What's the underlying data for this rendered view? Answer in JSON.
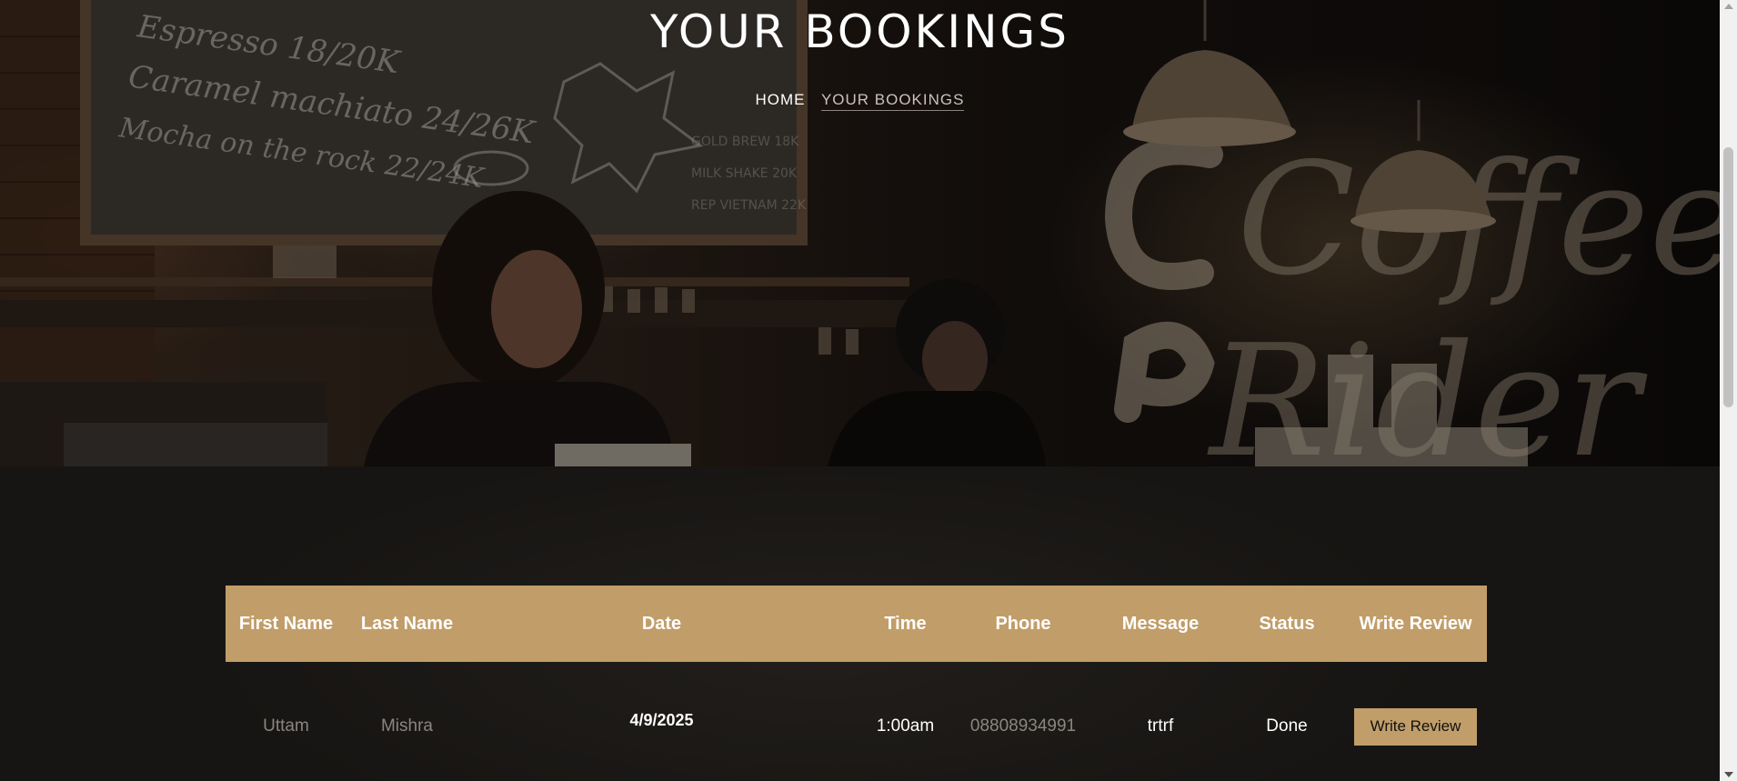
{
  "hero": {
    "title": "YOUR BOOKINGS",
    "breadcrumb": {
      "home": "HOME",
      "current": "YOUR BOOKINGS"
    },
    "photo_menu_lines": [
      "Espresso 18/20K",
      "Caramel machiato 24/26K",
      "Mocha on the rock 22/24K"
    ],
    "photo_signage": [
      "Coffee",
      "Rider"
    ]
  },
  "table": {
    "headers": {
      "first_name": "First Name",
      "last_name": "Last Name",
      "date": "Date",
      "time": "Time",
      "phone": "Phone",
      "message": "Message",
      "status": "Status",
      "review": "Write Review"
    },
    "rows": [
      {
        "first_name": "Uttam",
        "last_name": "Mishra",
        "date": "4/9/2025",
        "time": "1:00am",
        "phone": "08808934991",
        "message": "trtrf",
        "status": "Done",
        "review_button": "Write Review"
      }
    ]
  },
  "colors": {
    "accent": "#c19d69",
    "background": "#171513",
    "text": "#ffffff",
    "muted": "#8a8580"
  }
}
